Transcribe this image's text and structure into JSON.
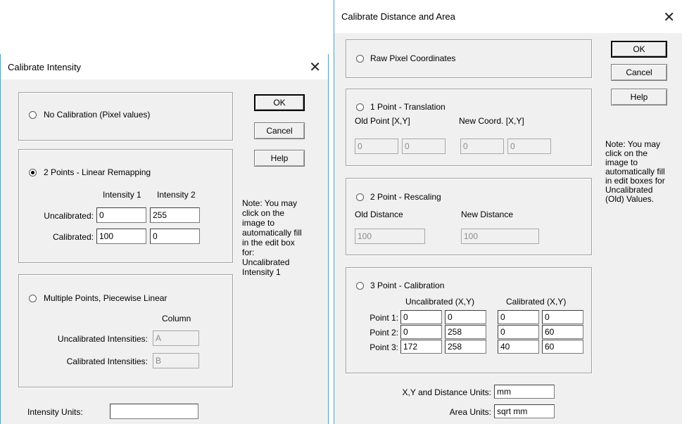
{
  "intensity_dialog": {
    "title": "Calibrate Intensity",
    "close_glyph": "✕",
    "no_calibration": {
      "label": "No Calibration (Pixel values)",
      "selected": false
    },
    "two_points": {
      "label": "2 Points - Linear Remapping",
      "selected": true,
      "col1": "Intensity 1",
      "col2": "Intensity 2",
      "uncal_label": "Uncalibrated:",
      "cal_label": "Calibrated:",
      "uncal_i1": "0",
      "uncal_i2": "255",
      "cal_i1": "100",
      "cal_i2": "0"
    },
    "multi_points": {
      "label": "Multiple Points, Piecewise Linear",
      "selected": false,
      "column_header": "Column",
      "uncal_label": "Uncalibrated Intensities:",
      "cal_label": "Calibrated Intensities:",
      "uncal_col": "A",
      "cal_col": "B"
    },
    "units_label": "Intensity Units:",
    "units_value": "",
    "buttons": {
      "ok": "OK",
      "cancel": "Cancel",
      "help": "Help"
    },
    "note": "Note: You may\nclick on the\nimage to\nautomatically fill\nin the edit box\nfor:\nUncalibrated\nIntensity 1"
  },
  "distance_dialog": {
    "title": "Calibrate Distance and Area",
    "close_glyph": "✕",
    "raw": {
      "label": "Raw Pixel Coordinates",
      "selected": false
    },
    "one_point": {
      "label": "1 Point - Translation",
      "selected": false,
      "old_label": "Old Point [X,Y]",
      "new_label": "New Coord. [X,Y]",
      "old_x": "0",
      "old_y": "0",
      "new_x": "0",
      "new_y": "0"
    },
    "two_point": {
      "label": "2 Point - Rescaling",
      "selected": false,
      "old_label": "Old Distance",
      "new_label": "New Distance",
      "old_value": "100",
      "new_value": "100"
    },
    "three_point": {
      "label": "3 Point - Calibration",
      "selected": true,
      "uncal_header": "Uncalibrated (X,Y)",
      "cal_header": "Calibrated (X,Y)",
      "rows": [
        {
          "label": "Point 1:",
          "ux": "0",
          "uy": "0",
          "cx": "0",
          "cy": "0"
        },
        {
          "label": "Point 2:",
          "ux": "0",
          "uy": "258",
          "cx": "0",
          "cy": "60"
        },
        {
          "label": "Point 3:",
          "ux": "172",
          "uy": "258",
          "cx": "40",
          "cy": "60"
        }
      ]
    },
    "dist_units_label": "X,Y and Distance Units:",
    "dist_units_value": "mm",
    "area_units_label": "Area Units:",
    "area_units_value": "sqrt mm",
    "buttons": {
      "ok": "OK",
      "cancel": "Cancel",
      "help": "Help"
    },
    "note": "Note: You may\nclick on the\nimage to\nautomatically fill\nin edit boxes for\nUncalibrated\n(Old) Values."
  }
}
